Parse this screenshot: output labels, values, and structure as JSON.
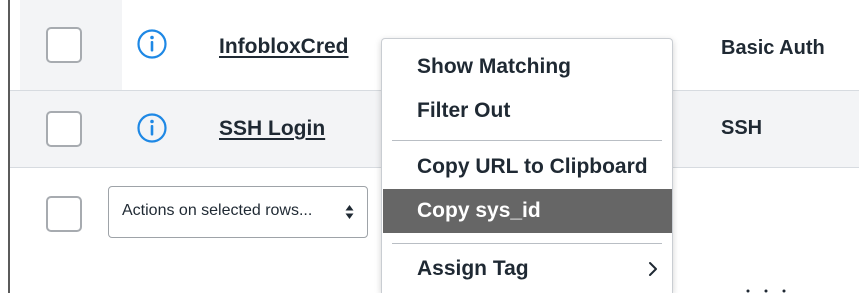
{
  "table": {
    "rows": [
      {
        "name": "InfobloxCred",
        "type": "Basic Auth",
        "icon": "info-circle-icon"
      },
      {
        "name": "SSH Login",
        "type": "SSH",
        "icon": "info-circle-icon"
      }
    ]
  },
  "actions": {
    "select_label": "Actions on selected rows...",
    "icon": "up-down-arrows-icon"
  },
  "context_menu": {
    "items": [
      {
        "label": "Show Matching"
      },
      {
        "label": "Filter Out"
      },
      {
        "label": "Copy URL to Clipboard"
      },
      {
        "label": "Copy sys_id",
        "state": "highlighted"
      },
      {
        "label": "Assign Tag",
        "submenu": true,
        "icon": "chevron-right-icon"
      }
    ]
  },
  "colors": {
    "row_alt_bg": "#f3f4f6",
    "info_icon": "#1e88e5",
    "menu_highlight": "#666666",
    "text": "#1f2933"
  }
}
